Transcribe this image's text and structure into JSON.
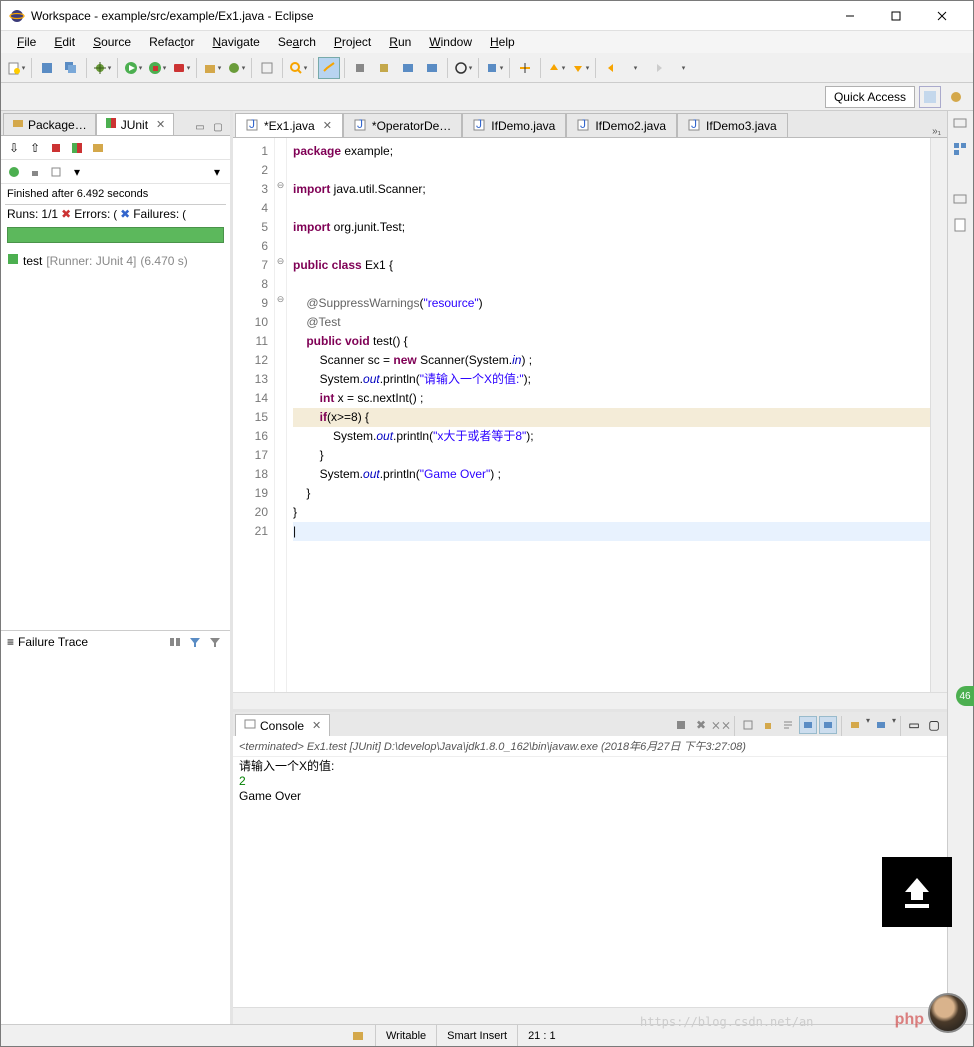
{
  "window": {
    "title": "Workspace - example/src/example/Ex1.java - Eclipse"
  },
  "menu": [
    "File",
    "Edit",
    "Source",
    "Refactor",
    "Navigate",
    "Search",
    "Project",
    "Run",
    "Window",
    "Help"
  ],
  "quick_access": "Quick Access",
  "left": {
    "tab_pkg": "Package…",
    "tab_junit": "JUnit",
    "status": "Finished after 6.492 seconds",
    "runs_label": "Runs:",
    "runs_val": "1/1",
    "errors_label": "Errors:",
    "failures_label": "Failures:",
    "test_label": "test",
    "runner": "[Runner: JUnit 4]",
    "test_time": "(6.470 s)",
    "failure_trace": "Failure Trace"
  },
  "editor_tabs": [
    {
      "label": "*Ex1.java",
      "active": true
    },
    {
      "label": "*OperatorDe…",
      "active": false
    },
    {
      "label": "IfDemo.java",
      "active": false
    },
    {
      "label": "IfDemo2.java",
      "active": false
    },
    {
      "label": "IfDemo3.java",
      "active": false
    }
  ],
  "code": {
    "lines": [
      [
        {
          "t": "package ",
          "c": "kw"
        },
        {
          "t": "example;"
        }
      ],
      [],
      [
        {
          "t": "import ",
          "c": "kw"
        },
        {
          "t": "java.util.Scanner;"
        }
      ],
      [],
      [
        {
          "t": "import ",
          "c": "kw"
        },
        {
          "t": "org.junit.Test;"
        }
      ],
      [],
      [
        {
          "t": "public class ",
          "c": "kw"
        },
        {
          "t": "Ex1 {"
        }
      ],
      [],
      [
        {
          "t": "    @SuppressWarnings",
          "c": "ann"
        },
        {
          "t": "("
        },
        {
          "t": "\"resource\"",
          "c": "str"
        },
        {
          "t": ")"
        }
      ],
      [
        {
          "t": "    @Test",
          "c": "ann"
        }
      ],
      [
        {
          "t": "    "
        },
        {
          "t": "public void ",
          "c": "kw"
        },
        {
          "t": "test() {"
        }
      ],
      [
        {
          "t": "        Scanner sc = "
        },
        {
          "t": "new ",
          "c": "kw"
        },
        {
          "t": "Scanner(System."
        },
        {
          "t": "in",
          "c": "fld"
        },
        {
          "t": ") ;"
        }
      ],
      [
        {
          "t": "        System."
        },
        {
          "t": "out",
          "c": "fld"
        },
        {
          "t": ".println("
        },
        {
          "t": "\"请输入一个X的值:\"",
          "c": "str"
        },
        {
          "t": ");"
        }
      ],
      [
        {
          "t": "        "
        },
        {
          "t": "int ",
          "c": "kw"
        },
        {
          "t": "x = sc.nextInt() ;"
        }
      ],
      [
        {
          "t": "        "
        },
        {
          "t": "if",
          "c": "kw"
        },
        {
          "t": "(x>=8) {"
        }
      ],
      [
        {
          "t": "            System."
        },
        {
          "t": "out",
          "c": "fld"
        },
        {
          "t": ".println("
        },
        {
          "t": "\"x大于或者等于8\"",
          "c": "str"
        },
        {
          "t": ");"
        }
      ],
      [
        {
          "t": "        }"
        }
      ],
      [
        {
          "t": "        System."
        },
        {
          "t": "out",
          "c": "fld"
        },
        {
          "t": ".println("
        },
        {
          "t": "\"Game Over\"",
          "c": "str"
        },
        {
          "t": ") ;"
        }
      ],
      [
        {
          "t": "    }"
        }
      ],
      [
        {
          "t": "}"
        }
      ],
      []
    ],
    "fold": [
      "",
      "",
      "⊖",
      "",
      "",
      "",
      "⊖",
      "",
      "⊖",
      "",
      "",
      "",
      "",
      "",
      "",
      "",
      "",
      "",
      "",
      "",
      ""
    ],
    "highlight_line": 15,
    "cursor_line": 21
  },
  "console": {
    "tab": "Console",
    "header": "<terminated> Ex1.test [JUnit] D:\\develop\\Java\\jdk1.8.0_162\\bin\\javaw.exe (2018年6月27日 下午3:27:08)",
    "out_prompt": "请输入一个X的值:",
    "out_input": "2",
    "out_result": "Game Over"
  },
  "status": {
    "writable": "Writable",
    "insert": "Smart Insert",
    "pos": "21 : 1"
  },
  "watermark": "https://blog.csdn.net/an",
  "phplogo": "php",
  "badge": "46"
}
